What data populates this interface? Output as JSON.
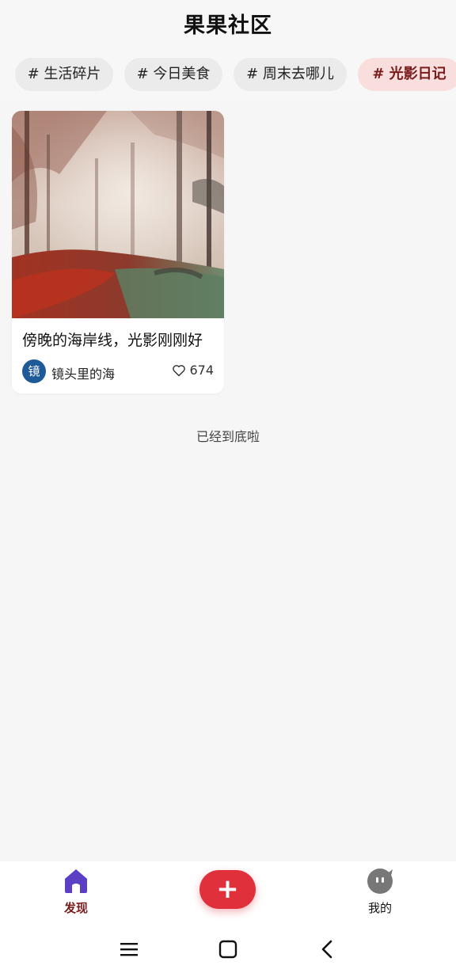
{
  "header": {
    "title": "果果社区"
  },
  "tabs": [
    {
      "label": "# 生活碎片",
      "active": false
    },
    {
      "label": "# 今日美食",
      "active": false
    },
    {
      "label": "# 周末去哪儿",
      "active": false
    },
    {
      "label": "# 光影日记",
      "active": true
    }
  ],
  "feed": {
    "posts": [
      {
        "title": "傍晚的海岸线，光影刚刚好",
        "author": "镜头里的海",
        "avatar_text": "镜",
        "likes": "674"
      }
    ],
    "end_text": "已经到底啦"
  },
  "bottom_nav": {
    "discover_label": "发现",
    "mine_label": "我的",
    "fab_symbol": "+"
  },
  "colors": {
    "accent": "#e0303c",
    "active_tab_bg": "#f9dede",
    "active_text": "#7a1b1b",
    "home_icon": "#5b3fc4",
    "avatar": "#1f5a98"
  }
}
